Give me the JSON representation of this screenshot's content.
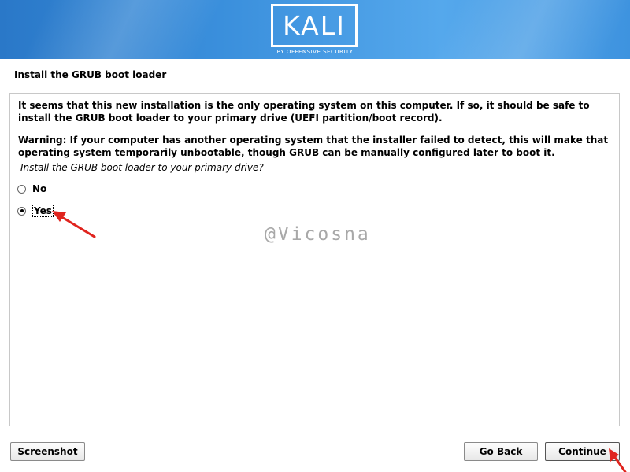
{
  "banner": {
    "logo_text": "KALI",
    "logo_subtitle": "BY OFFENSIVE SECURITY",
    "gradient_colors": [
      "#2a78c8",
      "#55a8ec"
    ]
  },
  "page": {
    "title": "Install the GRUB boot loader"
  },
  "content": {
    "paragraph1": "It seems that this new installation is the only operating system on this computer. If so, it should be safe to install the GRUB boot loader to your primary drive (UEFI partition/boot record).",
    "paragraph2": "Warning: If your computer has another operating system that the installer failed to detect, this will make that operating system temporarily unbootable, though GRUB can be manually configured later to boot it.",
    "question": "Install the GRUB boot loader to your primary drive?",
    "options": [
      {
        "label": "No",
        "selected": false
      },
      {
        "label": "Yes",
        "selected": true
      }
    ],
    "watermark": "@Vicosna"
  },
  "buttons": {
    "screenshot": "Screenshot",
    "go_back": "Go Back",
    "continue": "Continue"
  },
  "annotations": {
    "arrow_color": "#e0241e"
  }
}
